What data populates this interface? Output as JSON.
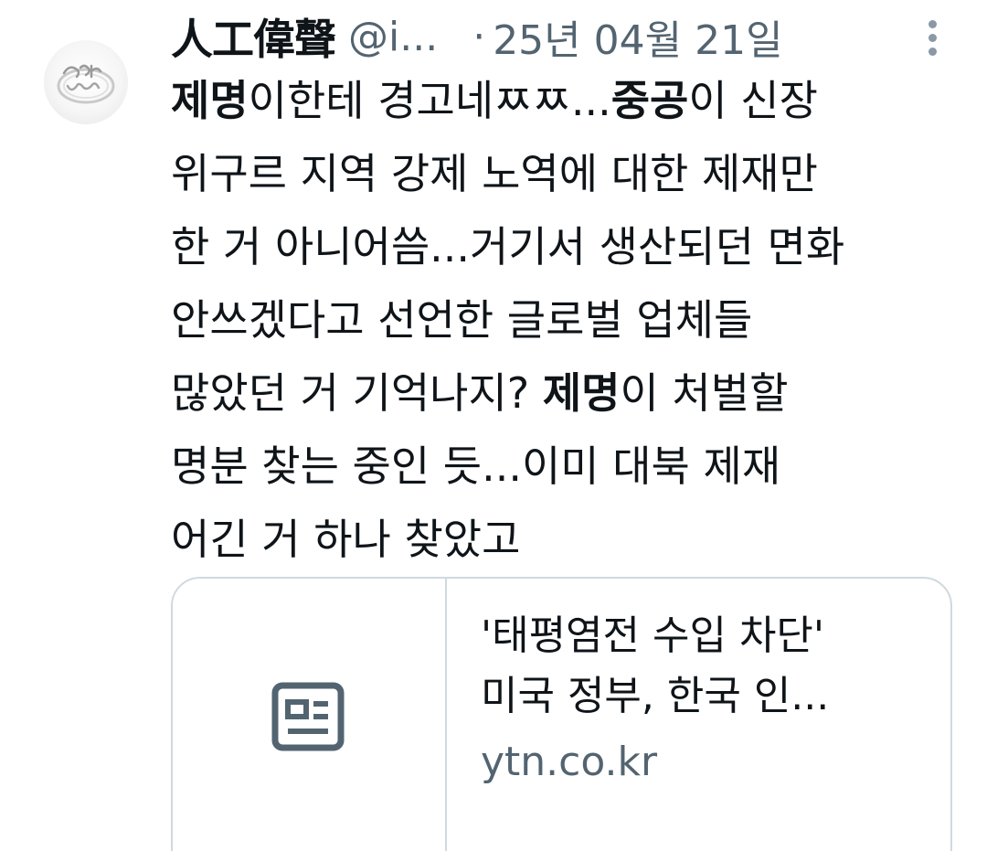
{
  "tweet": {
    "author": {
      "display_name": "人工偉聲",
      "handle": "@i...",
      "avatar_icon": "ring-avatar-icon"
    },
    "separator": "·",
    "date": "25년 04월 21일",
    "more_icon": "more-vertical-icon",
    "body_lines": [
      {
        "parts": [
          {
            "text": "제명",
            "bold": true
          },
          {
            "text": "이한테 경고네ㅉㅉ...",
            "bold": false
          },
          {
            "text": "중공",
            "bold": true
          },
          {
            "text": "이 신장",
            "bold": false
          }
        ]
      },
      {
        "parts": [
          {
            "text": "위구르 지역 강제 노역에 대한 제재만",
            "bold": false
          }
        ]
      },
      {
        "parts": [
          {
            "text": "한 거 아니어씀...거기서 생산되던 면화",
            "bold": false
          }
        ]
      },
      {
        "parts": [
          {
            "text": "안쓰겠다고 선언한 글로벌 업체들",
            "bold": false
          }
        ]
      },
      {
        "parts": [
          {
            "text": "많았던 거 기억나지? ",
            "bold": false
          },
          {
            "text": "제명",
            "bold": true
          },
          {
            "text": "이 처벌할",
            "bold": false
          }
        ]
      },
      {
        "parts": [
          {
            "text": "명분 찾는 중인 듯...이미 대북 제재",
            "bold": false
          }
        ]
      },
      {
        "parts": [
          {
            "text": "어긴 거 하나 찾았고",
            "bold": false
          }
        ]
      }
    ],
    "link_card": {
      "thumbnail_icon": "article-icon",
      "title_line1": "'태평염전 수입 차단'",
      "title_line2": "미국 정부, 한국 인...",
      "domain": "ytn.co.kr"
    }
  },
  "colors": {
    "text_primary": "#0f1419",
    "text_secondary": "#536471",
    "border": "#cfd9de",
    "icon_gray": "#8b98a5"
  }
}
